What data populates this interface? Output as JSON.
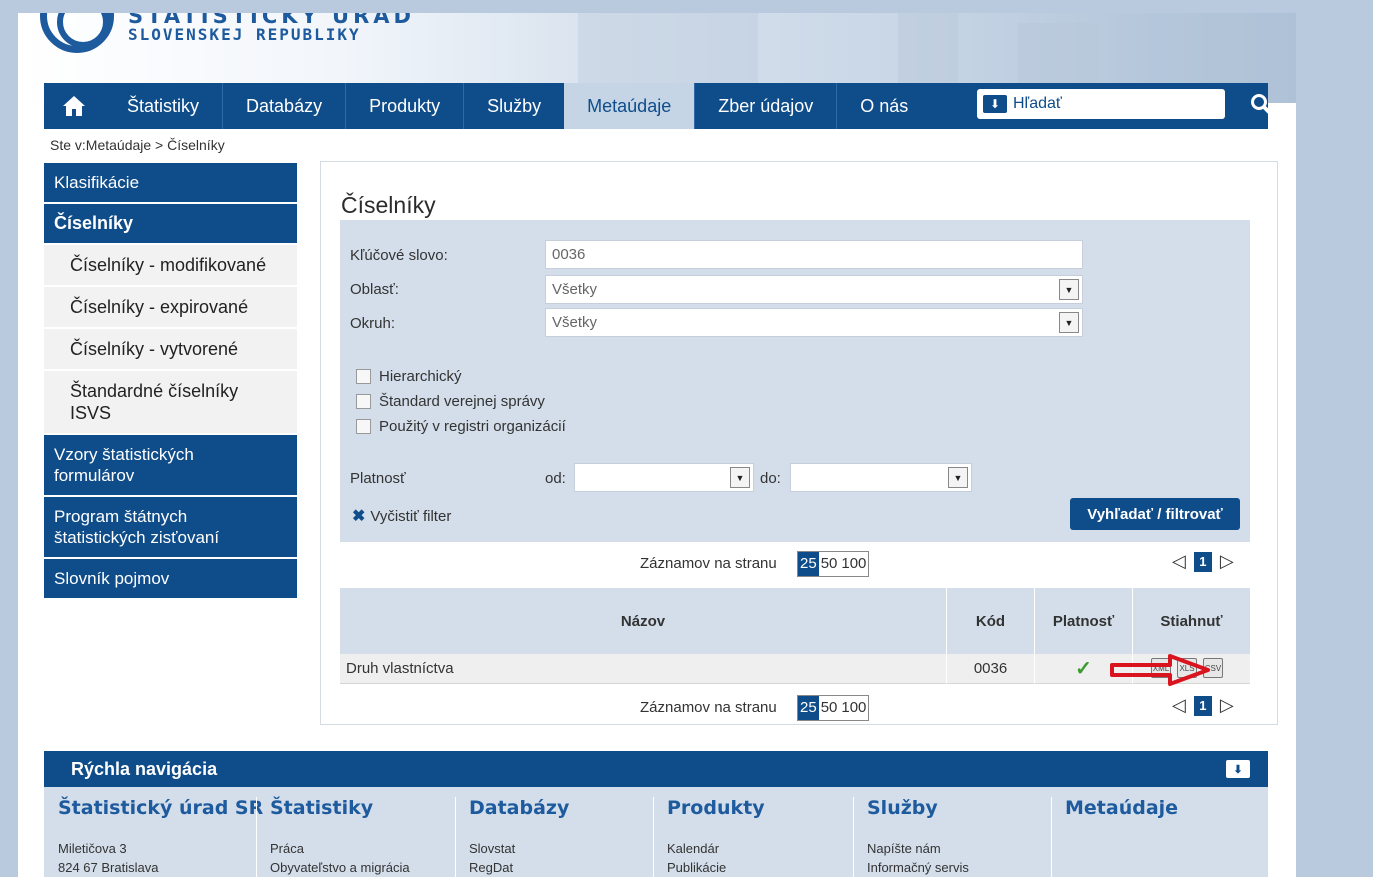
{
  "header": {
    "logo_top": "ŠTATISTICKÝ ÚRAD",
    "logo_bottom": "SLOVENSKEJ REPUBLIKY"
  },
  "nav": {
    "items": [
      "Štatistiky",
      "Databázy",
      "Produkty",
      "Služby",
      "Metaúdaje",
      "Zber údajov",
      "O nás"
    ],
    "active": "Metaúdaje",
    "search_value": "Hľadať"
  },
  "breadcrumb": "Ste v:Metaúdaje > Číselníky",
  "sidebar": {
    "items": [
      {
        "label": "Klasifikácie"
      },
      {
        "label": "Číselníky"
      },
      {
        "label": "Číselníky - modifikované"
      },
      {
        "label": "Číselníky - expirované"
      },
      {
        "label": "Číselníky - vytvorené"
      },
      {
        "label": "Štandardné číselníky ISVS"
      },
      {
        "label": "Vzory štatistických formulárov"
      },
      {
        "label": "Program štátnych štatistických zisťovaní"
      },
      {
        "label": "Slovník pojmov"
      }
    ]
  },
  "panel": {
    "title": "Číselníky",
    "filter": {
      "keyword_label": "Kľúčové slovo:",
      "keyword_value": "0036",
      "area_label": "Oblasť:",
      "area_value": "Všetky",
      "circuit_label": "Okruh:",
      "circuit_value": "Všetky",
      "checkboxes": [
        "Hierarchický",
        "Štandard verejnej správy",
        "Použitý v registri organizácií"
      ],
      "validity_label": "Platnosť",
      "from_label": "od:",
      "to_label": "do:",
      "clear_label": "Vyčistiť filter",
      "search_button": "Vyhľadať / filtrovať"
    },
    "pager": {
      "label": "Záznamov na stranu",
      "sizes": [
        "25",
        "50",
        "100"
      ],
      "selected": "25",
      "current_page": "1",
      "prev": "◁",
      "next": "▷"
    },
    "table": {
      "headers": [
        "Názov",
        "Kód",
        "Platnosť",
        "Stiahnuť"
      ],
      "rows": [
        {
          "name": "Druh vlastníctva",
          "code": "0036",
          "valid": "✓"
        }
      ],
      "file_icons": [
        "XML",
        "XLS",
        "CSV"
      ]
    }
  },
  "footer": {
    "title": "Rýchla navigácia",
    "columns": [
      {
        "heading": "Štatistický úrad SR",
        "lines": [
          "Miletičova 3",
          "824 67 Bratislava"
        ]
      },
      {
        "heading": "Štatistiky",
        "lines": [
          "Práca",
          "Obyvateľstvo a migrácia"
        ]
      },
      {
        "heading": "Databázy",
        "lines": [
          "Slovstat",
          "RegDat"
        ]
      },
      {
        "heading": "Produkty",
        "lines": [
          "Kalendár",
          "Publikácie"
        ]
      },
      {
        "heading": "Služby",
        "lines": [
          "Napíšte nám",
          "Informačný servis"
        ]
      },
      {
        "heading": "Metaúdaje",
        "lines": []
      }
    ]
  },
  "colors": {
    "brand_blue": "#0f4c8a",
    "panel_blue": "#d3deea",
    "annotation_red": "#d9141e",
    "check_green": "#3c9a2e"
  }
}
